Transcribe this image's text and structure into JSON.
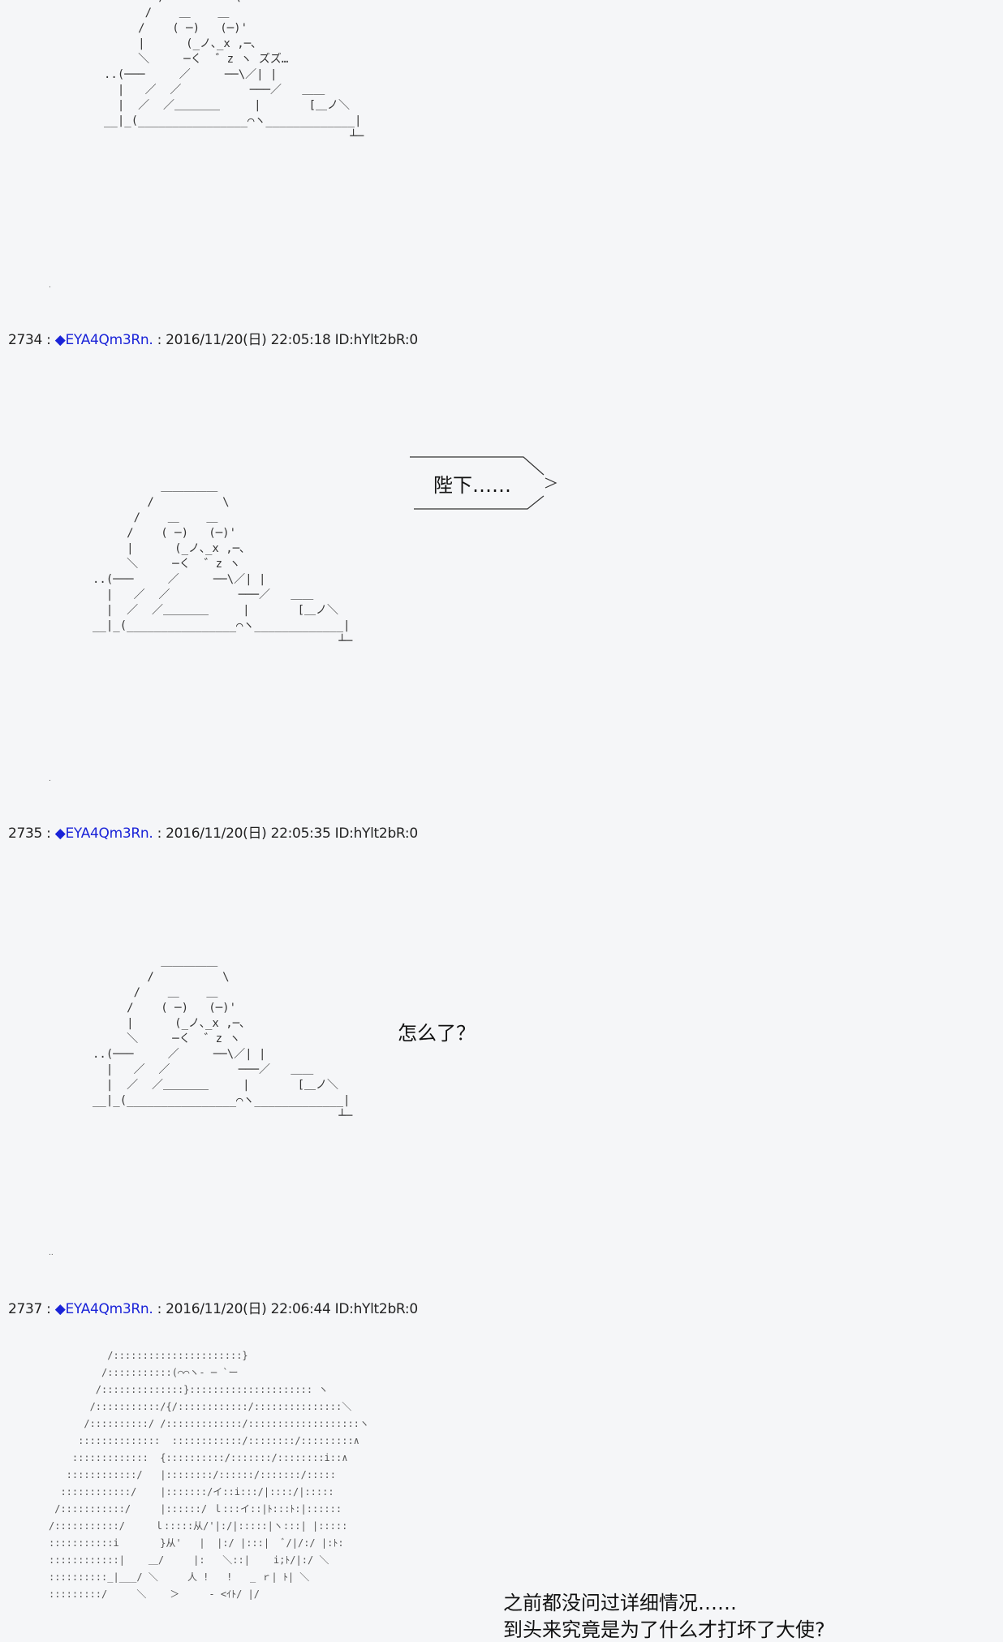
{
  "posts": [
    {
      "number": "2734",
      "separator": " : ",
      "name": "◆EYA4Qm3Rn.",
      "date_sep": " : ",
      "datetime": "2016/11/20(日) 22:05:18 ID:hYlt2bR:0"
    },
    {
      "number": "2735",
      "separator": " : ",
      "name": "◆EYA4Qm3Rn.",
      "date_sep": " : ",
      "datetime": "2016/11/20(日) 22:05:35 ID:hYlt2bR:0"
    },
    {
      "number": "2737",
      "separator": " : ",
      "name": "◆EYA4Qm3Rn.",
      "date_sep": " : ",
      "datetime": "2016/11/20(日) 22:06:44 ID:hYlt2bR:0"
    }
  ],
  "separator_dot": ".",
  "separator_dots": "..",
  "art": {
    "top_sleeper": "        /          \\\n      /    ＿    ＿\n     /    ( ─)   (─)'\n     |      (_ノ､_x ,─､\n     ＼     ─く  ゛z ヽ ズズ…\n..(───     ／     ──\\／| |\n  |   ／  ／          ───／   ＿＿\n  |  ／  ／＿＿＿＿     |       [＿ノ＼\n__|_(________________⌒ヽ_____________|\n                                    ┴─",
    "sleeper": "          ＿＿＿＿＿\n        /          \\\n      /    ＿    ＿\n     /    ( ─)   (─)'\n     |      (_ノ､_x ,─､\n     ＼     ─く  ゛z ヽ\n..(───     ／     ──\\／| |\n  |   ／  ／          ───／   ＿＿\n  |  ／  ／＿＿＿＿     |       [＿ノ＼\n__|_(________________⌒ヽ_____________|\n                                    ┴─",
    "dense": "          /::::::::::::::::::::::}\n         /:::::::::::(⌒⌒ヽ‐ ─ `ー\n        /::::::::::::::}::::::::::::::::::::: ヽ\n       /:::::::::::/{/::::::::::::/:::::::::::::::＼\n      /::::::::::/ /:::::::::::::/:::::::::::::::::::ヽ\n     ::::::::::::::  ::::::::::::/::::::::/:::::::::∧\n    :::::::::::::  {::::::::::/:::::::/::::::::i::∧\n   ::::::::::::/   |::::::::/::::::/:::::::/:::::\n  ::::::::::::/    |:::::::/イ::i:::/|::::/|:::::\n /:::::::::::/     |::::::/ ｌ:::イ::|ﾄ:::ﾄ:|::::::\n/:::::::::::/     ｌ:::::从/'|:/|:::::|ヽ:::| |:::::\n:::::::::::i       }从'   |  |:/ |:::|  ﾞ/|/:/ |:ﾄ:\n::::::::::::|    ＿/     |:   ＼::|    i;ﾄ/|:/ ＼\n::::::::::_|___/ ＼     人 !   !   _ ｒ| ﾄ| ＼\n:::::::::/     ＼    ＞     ‐ <ｲﾄ/ |/"
  },
  "dialogue": {
    "line1": "陛下……",
    "line2": "怎么了？",
    "line3": "之前都没问过详细情况……",
    "line4": "到头来究竟是为了什么才打坏了大使?"
  },
  "colors": {
    "background": "#f5f6f8",
    "name_link": "#1a23d8",
    "text": "#222222"
  }
}
